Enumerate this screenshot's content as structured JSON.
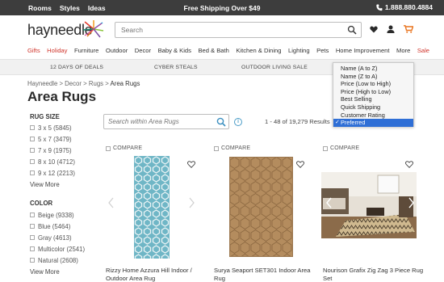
{
  "topbar": {
    "links": [
      "Rooms",
      "Styles",
      "Ideas"
    ],
    "promo": "Free Shipping Over $49",
    "phone": "1.888.880.4884"
  },
  "header": {
    "logo": "hayneedle",
    "search_placeholder": "Search"
  },
  "catnav": {
    "items": [
      "Gifts",
      "Holiday",
      "Furniture",
      "Outdoor",
      "Decor",
      "Baby & Kids",
      "Bed & Bath",
      "Kitchen & Dining",
      "Lighting",
      "Pets",
      "Home Improvement",
      "More",
      "Sale"
    ]
  },
  "promo_bar": {
    "items": [
      "12 DAYS OF DEALS",
      "CYBER STEALS",
      "OUTDOOR LIVING SALE"
    ]
  },
  "breadcrumb": [
    "Hayneedle",
    "Decor",
    "Rugs",
    "Area Rugs"
  ],
  "page_title": "Area Rugs",
  "sidebar": {
    "rug_size": {
      "heading": "RUG SIZE",
      "items": [
        "3 x 5 (5845)",
        "5 x 7 (3479)",
        "7 x 9 (1975)",
        "8 x 10 (4712)",
        "9 x 12 (2213)"
      ],
      "view_more": "View More"
    },
    "color": {
      "heading": "COLOR",
      "items": [
        "Beige (9338)",
        "Blue (5464)",
        "Gray (4613)",
        "Multicolor (2541)",
        "Natural (2608)"
      ],
      "view_more": "View More"
    }
  },
  "within_search": {
    "placeholder": "Search within Area Rugs"
  },
  "results_text": "1 - 48 of 19,279 Results",
  "sort_menu": {
    "options": [
      "Name (A to Z)",
      "Name (Z to A)",
      "Price (Low to High)",
      "Price (High to Low)",
      "Best Selling",
      "Quick Shipping",
      "Customer Rating",
      "Preferred"
    ],
    "selected": "Preferred",
    "check": "✓"
  },
  "products": [
    {
      "compare": "COMPARE",
      "title": "Rizzy Home Azzura Hill Indoor / Outdoor Area Rug",
      "colors": {
        "base": "#6fb6c6",
        "pattern": "#e9f3f5"
      }
    },
    {
      "compare": "COMPARE",
      "title": "Surya Seaport SET301 Indoor Area Rug",
      "colors": {
        "base": "#b48c5e",
        "pattern": "#8e6a42"
      }
    },
    {
      "compare": "COMPARE",
      "title": "Nourison Grafix Zig Zag 3 Piece Rug Set",
      "colors": {
        "base": "#cfb98f",
        "pattern": "#4a3d2c"
      }
    }
  ],
  "colors": {
    "topbar": "#3d3d3d",
    "sale_red": "#d0352c",
    "orange_cart": "#e9741e",
    "selected_blue": "#2f6fd6"
  }
}
